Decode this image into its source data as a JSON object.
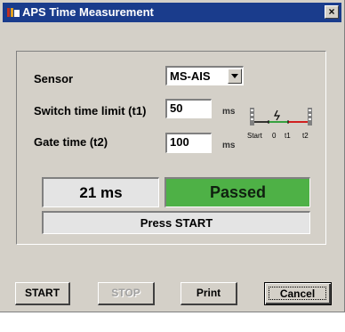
{
  "window": {
    "title": "APS Time Measurement",
    "close_label": "×"
  },
  "form": {
    "sensor_label": "Sensor",
    "sensor_value": "MS-AIS",
    "switch_time_label": "Switch time limit (t1)",
    "switch_time_value": "50",
    "switch_time_unit": "ms",
    "gate_time_label": "Gate time (t2)",
    "gate_time_value": "100",
    "gate_time_unit": "ms"
  },
  "diagram": {
    "start_label": "Start",
    "zero_label": "0",
    "t1_label": "t1",
    "t2_label": "t2"
  },
  "result": {
    "time_text": "21 ms",
    "status_text": "Passed",
    "message_text": "Press START"
  },
  "buttons": {
    "start": "START",
    "stop": "STOP",
    "print": "Print",
    "cancel": "Cancel"
  },
  "colors": {
    "titlebar": "#1a3c8c",
    "passed": "#4eb146",
    "window_bg": "#d4d0c8"
  }
}
